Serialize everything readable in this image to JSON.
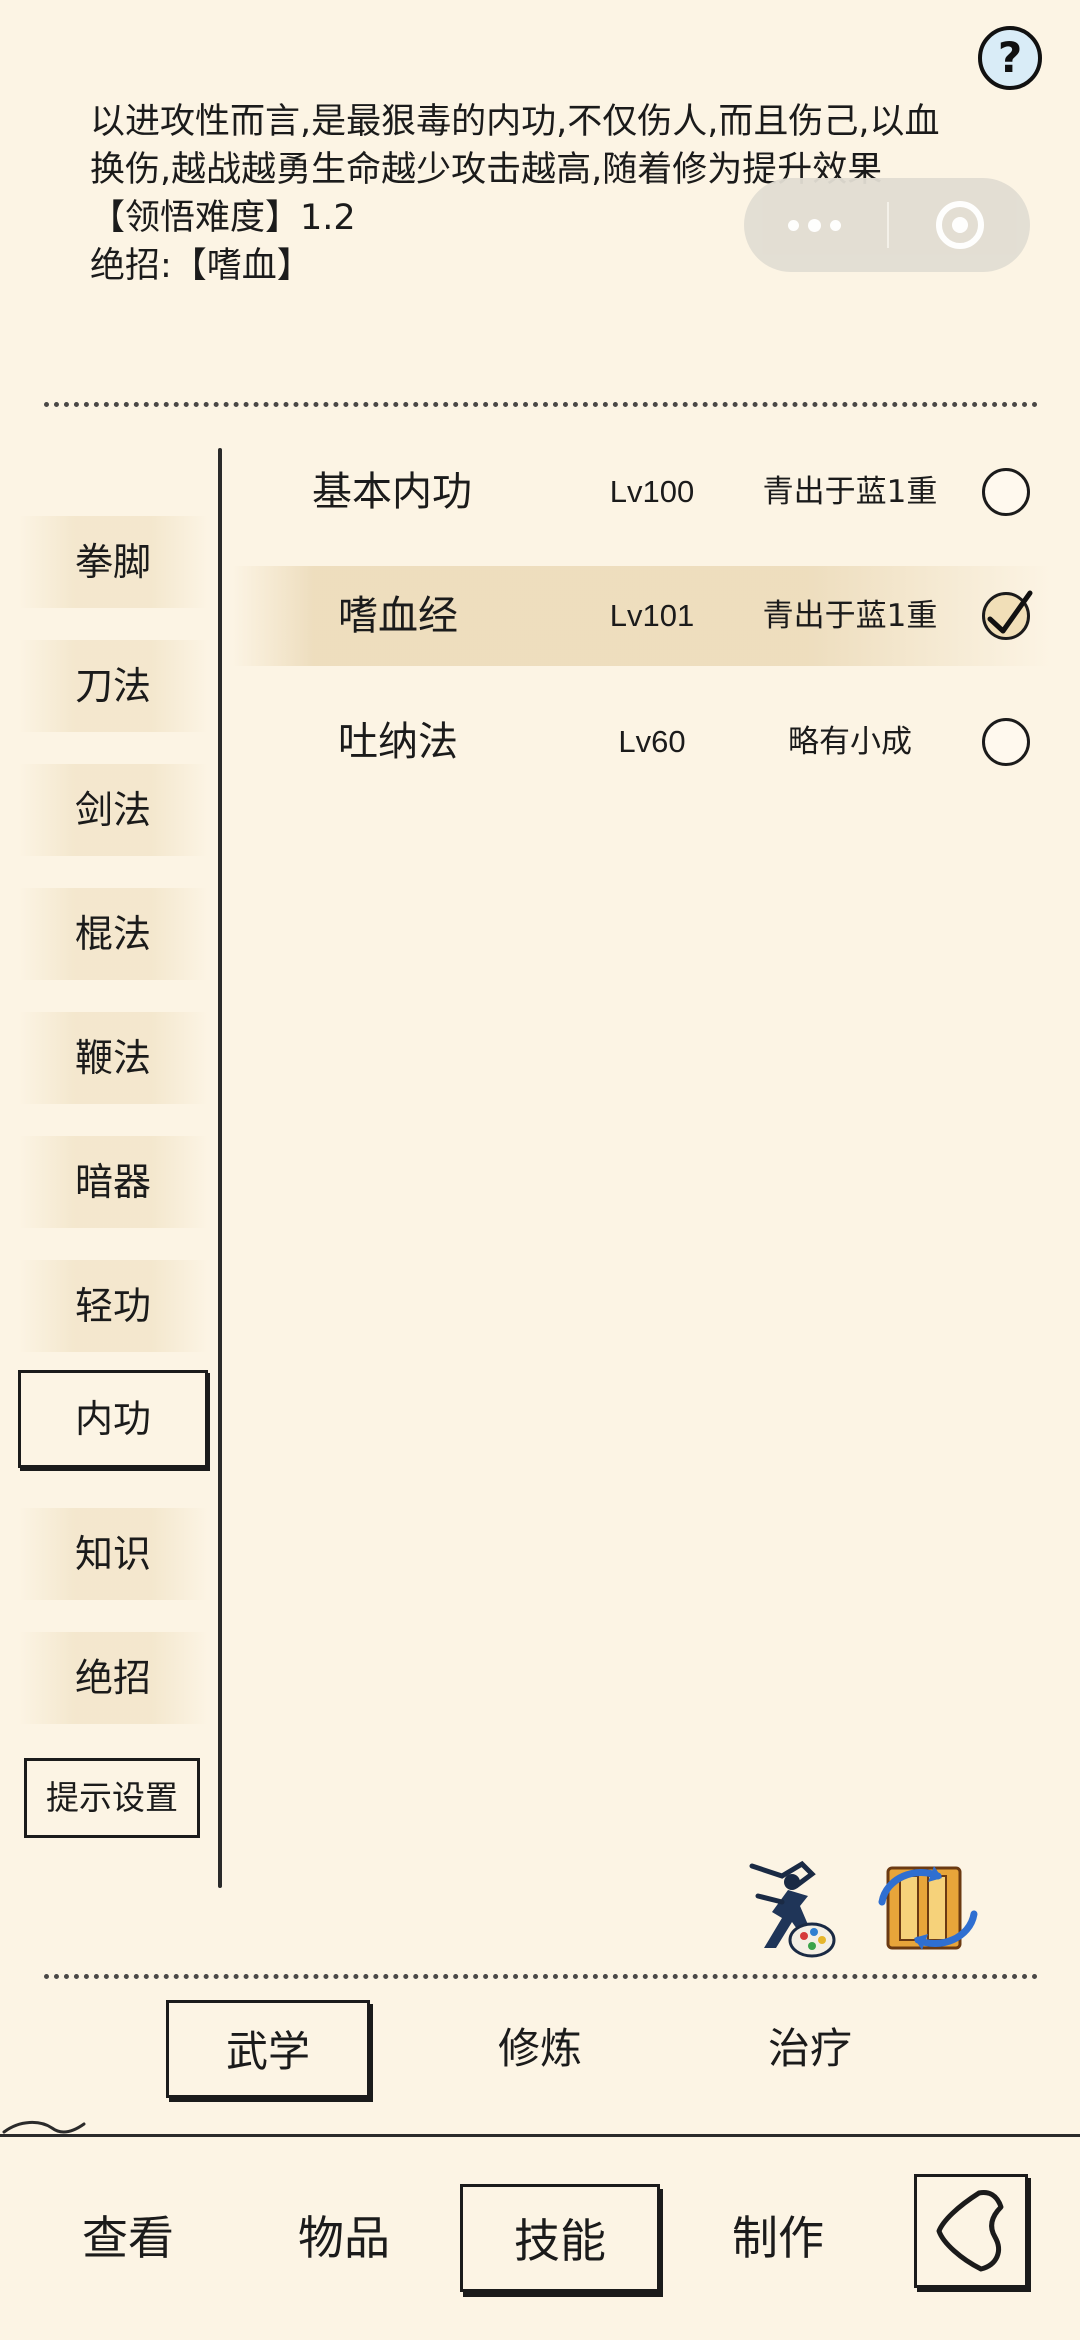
{
  "description": {
    "line1": "以进攻性而言,是最狠毒的内功,不仅伤人,而且伤己,以血",
    "line2": "换伤,越战越勇生命越少攻击越高,随着修为提升效果",
    "difficulty_label": "【领悟难度】",
    "difficulty_value": "1.2",
    "ultimate_label": "绝招:",
    "ultimate_value": "【嗜血】"
  },
  "help": {
    "glyph": "?"
  },
  "sidebar": {
    "categories": [
      "拳脚",
      "刀法",
      "剑法",
      "棍法",
      "鞭法",
      "暗器",
      "轻功",
      "内功",
      "知识",
      "绝招"
    ],
    "active": "内功",
    "tip_settings_label": "提示设置"
  },
  "skills": [
    {
      "name": "基本内功",
      "level": "Lv100",
      "rank": "青出于蓝1重",
      "selected": false
    },
    {
      "name": "嗜血经",
      "level": "Lv101",
      "rank": "青出于蓝1重",
      "selected": true
    },
    {
      "name": "吐纳法",
      "level": "Lv60",
      "rank": "略有小成",
      "selected": false
    }
  ],
  "subtabs": [
    "武学",
    "修炼",
    "治疗"
  ],
  "subtab_active": "武学",
  "bottom_nav": [
    "查看",
    "物品",
    "技能",
    "制作"
  ],
  "bottom_nav_active": "技能",
  "icons": {
    "help": "question-icon",
    "capsule_more": "more-dots-icon",
    "capsule_close": "close-target-icon",
    "martial": "martial-artist-icon",
    "scroll": "scroll-swap-icon",
    "back": "back-arrow-icon",
    "check": "check-icon"
  },
  "colors": {
    "background": "#fcf4e4",
    "text": "#1b1b1b",
    "highlight": "#ecdbba",
    "help_bg": "#d9ecf7"
  }
}
